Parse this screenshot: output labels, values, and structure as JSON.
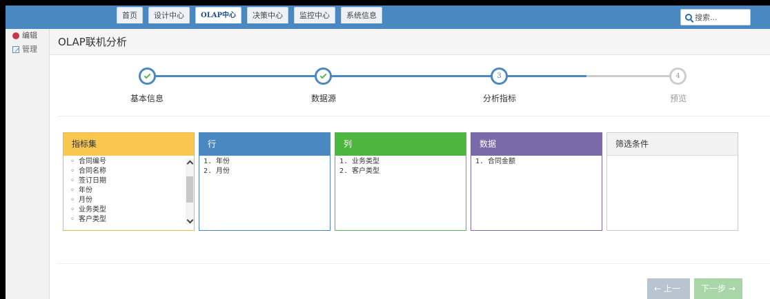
{
  "nav": [
    "首页",
    "设计中心",
    "OLAP中心",
    "决策中心",
    "监控中心",
    "系统信息"
  ],
  "nav_active_index": 2,
  "search": {
    "placeholder": "搜索..."
  },
  "sidebar": {
    "items": [
      {
        "label": "编辑",
        "icon": "edit-icon"
      },
      {
        "label": "管理",
        "icon": "manage-icon"
      }
    ]
  },
  "page": {
    "title": "OLAP联机分析"
  },
  "steps": [
    {
      "label": "基本信息",
      "status": "done"
    },
    {
      "label": "数据源",
      "status": "done"
    },
    {
      "label": "分析指标",
      "status": "current",
      "number": "3"
    },
    {
      "label": "预览",
      "status": "todo",
      "number": "4"
    }
  ],
  "panels": {
    "indicators": {
      "title": "指标集",
      "items": [
        "合同编号",
        "合同名称",
        "签订日期",
        "年份",
        "月份",
        "业务类型",
        "客户类型"
      ]
    },
    "rows": {
      "title": "行",
      "items": [
        "1. 年份",
        "2. 月份"
      ]
    },
    "columns": {
      "title": "列",
      "items": [
        "1. 业务类型",
        "2. 客户类型"
      ]
    },
    "data": {
      "title": "数据",
      "items": [
        "1. 合同金额"
      ]
    },
    "filters": {
      "title": "筛选条件",
      "items": []
    }
  },
  "buttons": {
    "prev": "← 上一步",
    "next": "下一步 →"
  },
  "colors": {
    "primary": "#4a88c1",
    "indicator": "#f9c74f",
    "rows": "#4a88c1",
    "columns": "#4db63f",
    "data": "#7b6aa9"
  }
}
